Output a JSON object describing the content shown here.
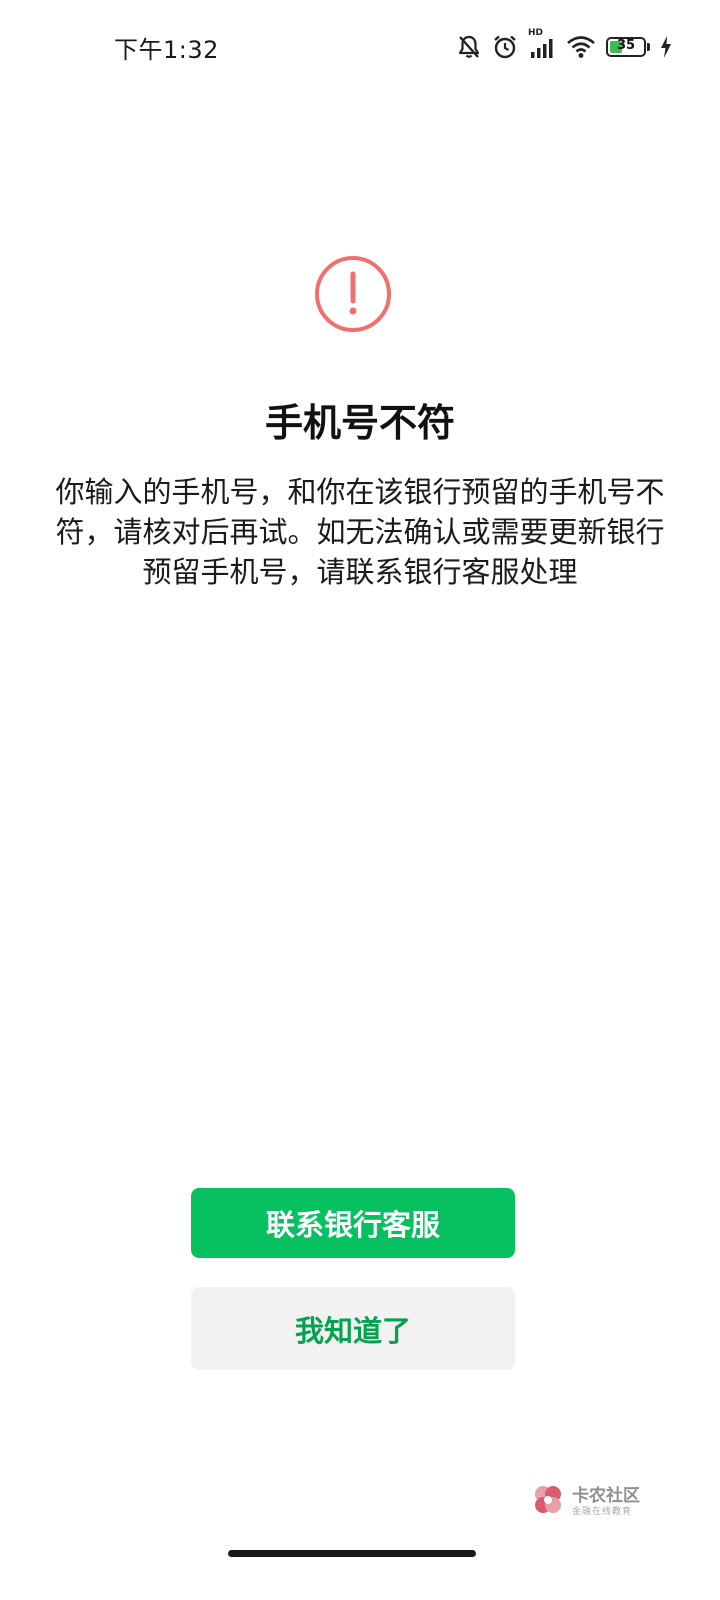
{
  "status_bar": {
    "time": "下午1:32",
    "network_label": "HD",
    "battery_level": "35",
    "icons": [
      "bell-off-icon",
      "alarm-icon",
      "signal-icon",
      "wifi-icon",
      "battery-icon",
      "charging-icon"
    ]
  },
  "dialog": {
    "icon": "exclamation-circle-icon",
    "icon_color": "#f07070",
    "title": "手机号不符",
    "description": "你输入的手机号，和你在该银行预留的手机号不符，请核对后再试。如无法确认或需要更新银行预留手机号，请联系银行客服处理"
  },
  "actions": {
    "primary_label": "联系银行客服",
    "secondary_label": "我知道了",
    "primary_color": "#07c160",
    "secondary_text_color": "#07a24e"
  },
  "watermark": {
    "title": "卡农社区",
    "subtitle": "金融在线教育"
  }
}
